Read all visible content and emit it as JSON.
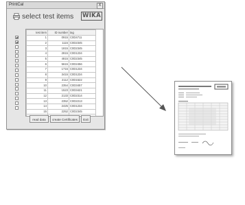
{
  "window": {
    "title": "PrintCal",
    "close": "X"
  },
  "header": {
    "title": "select test items",
    "logo": "WIKA"
  },
  "table": {
    "columns": [
      "test item",
      "ID number",
      "tag"
    ],
    "rows": [
      {
        "checked": true,
        "item": "1",
        "id": "0915",
        "tag": "C0D4711"
      },
      {
        "checked": true,
        "item": "2",
        "id": "1115",
        "tag": "C0D2345"
      },
      {
        "checked": false,
        "item": "3",
        "id": "1815",
        "tag": "C0D2345"
      },
      {
        "checked": false,
        "item": "4",
        "id": "2815",
        "tag": "C0D1234"
      },
      {
        "checked": false,
        "item": "5",
        "id": "4815",
        "tag": "C0D2345"
      },
      {
        "checked": false,
        "item": "6",
        "id": "5615",
        "tag": "C0D2456"
      },
      {
        "checked": false,
        "item": "7",
        "id": "1715",
        "tag": "C0D1234"
      },
      {
        "checked": false,
        "item": "8",
        "id": "3415",
        "tag": "C0D1234"
      },
      {
        "checked": false,
        "item": "9",
        "id": "2112",
        "tag": "C0D1522"
      },
      {
        "checked": false,
        "item": "10",
        "id": "2354",
        "tag": "C0D3457"
      },
      {
        "checked": false,
        "item": "11",
        "id": "1523",
        "tag": "C0D3421"
      },
      {
        "checked": false,
        "item": "12",
        "id": "2133",
        "tag": "C0D2314"
      },
      {
        "checked": false,
        "item": "13",
        "id": "2352",
        "tag": "C0D2213"
      },
      {
        "checked": false,
        "item": "14",
        "id": "2425",
        "tag": "C0D1234"
      },
      {
        "checked": false,
        "item": "15",
        "id": "2252",
        "tag": "C0D2345"
      },
      {
        "checked": false,
        "item": "16",
        "id": "1234",
        "tag": "C0D2333"
      }
    ]
  },
  "buttons": {
    "read": "read data",
    "create": "create Certificates",
    "exit": "Exit"
  },
  "icons": {
    "header": "printer-icon",
    "arrow": "arrow-icon",
    "document": "certificate-document-icon"
  }
}
